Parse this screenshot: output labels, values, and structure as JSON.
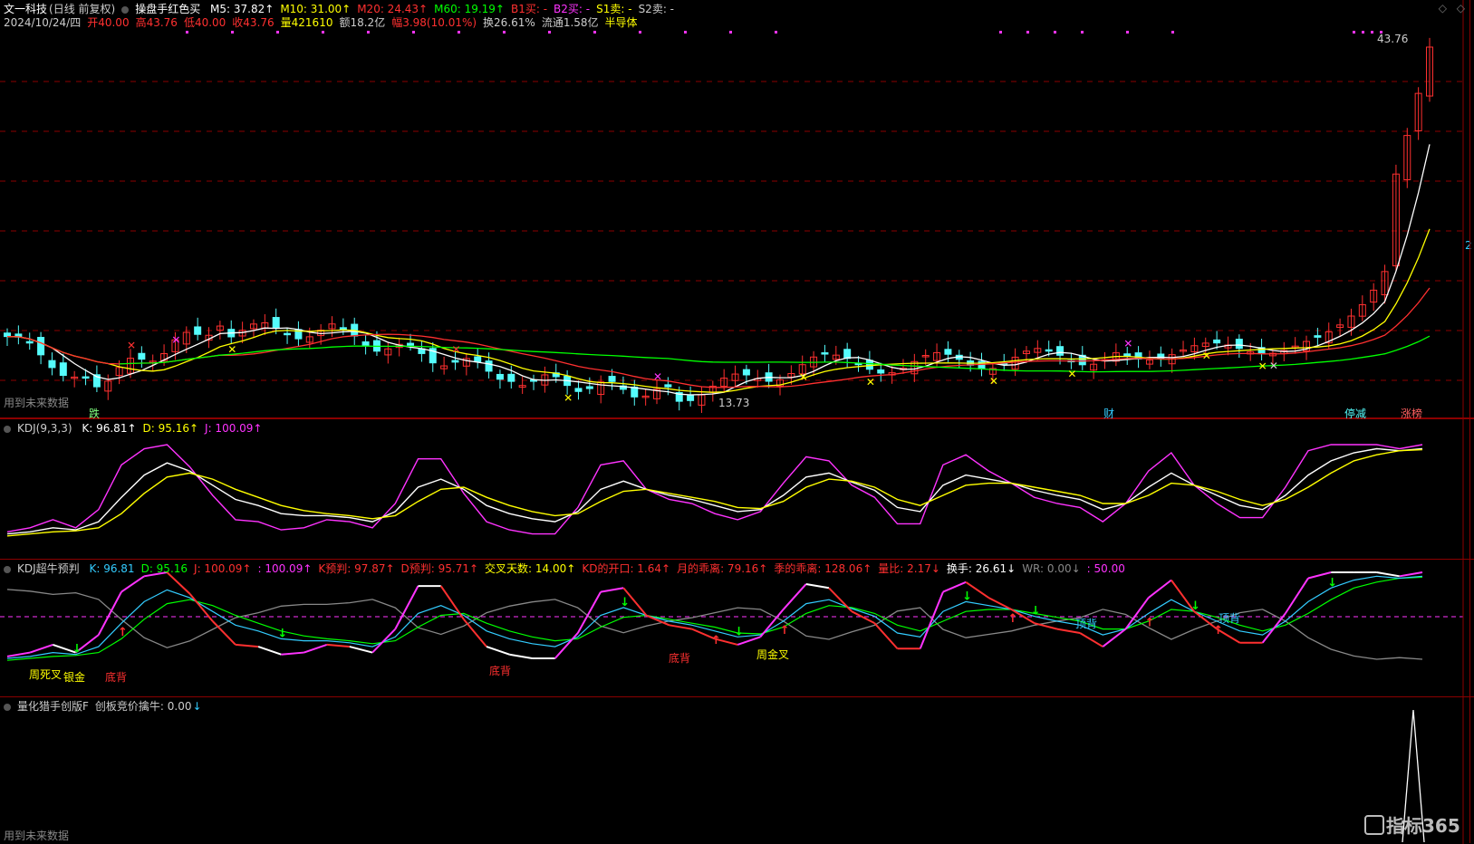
{
  "header": {
    "stock_name": "文一科技",
    "period": "(日线 前复权)",
    "indicator": "操盘手红色买",
    "ma": [
      {
        "label": "M5: 37.82",
        "arrow": "↑",
        "color": "#ffffff"
      },
      {
        "label": "M10: 31.00",
        "arrow": "↑",
        "color": "#ffff00"
      },
      {
        "label": "M20: 24.43",
        "arrow": "↑",
        "color": "#ff3030"
      },
      {
        "label": "M60: 19.19",
        "arrow": "↑",
        "color": "#00ff00"
      },
      {
        "label": "B1买: -",
        "arrow": "",
        "color": "#ff3030"
      },
      {
        "label": "B2买: -",
        "arrow": "",
        "color": "#ff33ff"
      },
      {
        "label": "S1卖: -",
        "arrow": "",
        "color": "#ffff00"
      },
      {
        "label": "S2卖: -",
        "arrow": "",
        "color": "#cccccc"
      }
    ],
    "line2": [
      {
        "text": "2024/10/24/四",
        "color": "#cccccc"
      },
      {
        "text": "开40.00",
        "color": "#ff3030"
      },
      {
        "text": "高43.76",
        "color": "#ff3030"
      },
      {
        "text": "低40.00",
        "color": "#ff3030"
      },
      {
        "text": "收43.76",
        "color": "#ff3030"
      },
      {
        "text": "量421610",
        "color": "#ffff00"
      },
      {
        "text": "额18.2亿",
        "color": "#cccccc"
      },
      {
        "text": "幅3.98(10.01%)",
        "color": "#ff3030"
      },
      {
        "text": "换26.61%",
        "color": "#cccccc"
      },
      {
        "text": "流通1.58亿",
        "color": "#cccccc"
      },
      {
        "text": "半导体",
        "color": "#ffff00"
      }
    ]
  },
  "main_labels": {
    "future_data": "用到未来数据",
    "high_price": "43.76",
    "low_price": "13.73",
    "die": "跌",
    "cai": "财",
    "tingjian": "停减",
    "zhangbang": "涨榜",
    "right_axis": "2"
  },
  "kdj": {
    "title": "KDJ(9,3,3)",
    "values": [
      {
        "label": "K: 96.81",
        "arrow": "↑",
        "color": "#ffffff"
      },
      {
        "label": "D: 95.16",
        "arrow": "↑",
        "color": "#ffff00"
      },
      {
        "label": "J: 100.09",
        "arrow": "↑",
        "color": "#ff33ff"
      }
    ]
  },
  "kdj2": {
    "title": "KDJ超牛预判",
    "values": [
      {
        "label": "K: 96.81",
        "color": "#33ccff"
      },
      {
        "label": "D: 95.16",
        "color": "#00ff00"
      },
      {
        "label": "J: 100.09",
        "arrow": "↑",
        "color": "#ff3030"
      },
      {
        "label": ": 100.09",
        "arrow": "↑",
        "color": "#ff33ff"
      },
      {
        "label": "K预判: 97.87",
        "arrow": "↑",
        "color": "#ff3030"
      },
      {
        "label": "D预判: 95.71",
        "arrow": "↑",
        "color": "#ff3030"
      },
      {
        "label": "交叉天数: 14.00",
        "arrow": "↑",
        "color": "#ffff00"
      },
      {
        "label": "KD的开口: 1.64",
        "arrow": "↑",
        "color": "#ff3030"
      },
      {
        "label": "月的乖离: 79.16",
        "arrow": "↑",
        "color": "#ff3030"
      },
      {
        "label": "季的乖离: 128.06",
        "arrow": "↑",
        "color": "#ff3030"
      },
      {
        "label": "量比: 2.17",
        "arrow": "↓",
        "color": "#ff3030"
      },
      {
        "label": "换手: 26.61",
        "arrow": "↓",
        "color": "#ffffff"
      },
      {
        "label": "WR: 0.00",
        "arrow": "↓",
        "color": "#888888"
      },
      {
        "label": ": 50.00",
        "arrow": "",
        "color": "#ff33ff"
      }
    ],
    "annotations": {
      "zhou_si_cha": "周死叉",
      "yin_jin": "银金",
      "di_bei_1": "底背",
      "di_bei_2": "底背",
      "di_bei_3": "底背",
      "zhou_jin_cha": "周金叉",
      "ding_bei_1": "顶背",
      "ding_bei_2": "顶背"
    }
  },
  "lh": {
    "title": "量化猎手创版F",
    "value": "创板竞价擒牛: 0.00",
    "arrow": "↓",
    "future_data": "用到未来数据",
    "watermark": "指标365"
  },
  "colors": {
    "up": "#ff3030",
    "down": "#54fcfc",
    "ma5": "#ffffff",
    "ma10": "#ffff00",
    "ma20": "#ff3030",
    "ma60": "#00ff00",
    "magenta": "#ff33ff",
    "cyan": "#33ccff",
    "grid": "#8b0000",
    "gray": "#888888"
  },
  "chart_data": [
    {
      "type": "line",
      "title": "KDJ(9,3,3)",
      "note": "approximate shape, full range 0-100",
      "series": [
        {
          "name": "K",
          "values": [
            12,
            14,
            18,
            16,
            24,
            48,
            70,
            82,
            74,
            60,
            46,
            40,
            32,
            30,
            30,
            28,
            24,
            34,
            58,
            66,
            56,
            40,
            32,
            27,
            24,
            34,
            56,
            64,
            56,
            50,
            46,
            40,
            34,
            36,
            50,
            68,
            72,
            63,
            55,
            38,
            34,
            60,
            70,
            66,
            62,
            55,
            50,
            46,
            36,
            42,
            58,
            72,
            60,
            50,
            40,
            36,
            50,
            70,
            84,
            92,
            96,
            94,
            96
          ]
        },
        {
          "name": "D",
          "values": [
            10,
            12,
            14,
            15,
            18,
            32,
            52,
            68,
            72,
            66,
            56,
            48,
            40,
            35,
            32,
            30,
            27,
            30,
            44,
            56,
            58,
            48,
            40,
            34,
            30,
            32,
            44,
            54,
            56,
            52,
            48,
            44,
            38,
            37,
            44,
            58,
            66,
            64,
            58,
            46,
            40,
            50,
            60,
            62,
            62,
            58,
            54,
            50,
            42,
            42,
            50,
            62,
            60,
            54,
            46,
            40,
            46,
            58,
            72,
            84,
            90,
            94,
            95
          ]
        },
        {
          "name": "J",
          "values": [
            14,
            18,
            26,
            18,
            36,
            80,
            96,
            100,
            78,
            50,
            26,
            24,
            16,
            18,
            26,
            24,
            18,
            42,
            86,
            86,
            52,
            24,
            16,
            12,
            12,
            38,
            80,
            84,
            56,
            46,
            42,
            32,
            26,
            34,
            62,
            88,
            84,
            60,
            48,
            22,
            22,
            80,
            90,
            74,
            62,
            48,
            42,
            38,
            24,
            42,
            74,
            92,
            60,
            42,
            28,
            28,
            58,
            94,
            100,
            100,
            100,
            96,
            100
          ]
        }
      ]
    }
  ]
}
